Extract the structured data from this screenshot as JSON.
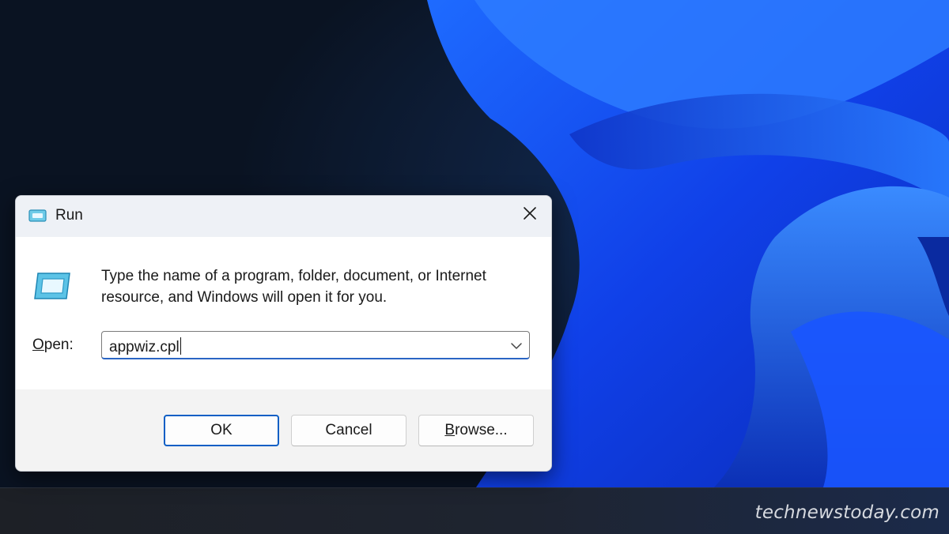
{
  "dialog": {
    "title": "Run",
    "close_icon": "close-icon",
    "app_icon": "run-app-icon",
    "description": "Type the name of a program, folder, document, or Internet resource, and Windows will open it for you.",
    "open_label_mnemonic": "O",
    "open_label_rest": "pen:",
    "open_value": "appwiz.cpl",
    "dropdown_icon": "chevron-down-icon",
    "buttons": {
      "ok": "OK",
      "cancel": "Cancel",
      "browse_mnemonic": "B",
      "browse_rest": "rowse..."
    }
  },
  "watermark": "technewstoday.com",
  "colors": {
    "accent": "#0d5fc5",
    "wallpaper_dark": "#0a1322",
    "wallpaper_blue": "#1f4cff"
  }
}
